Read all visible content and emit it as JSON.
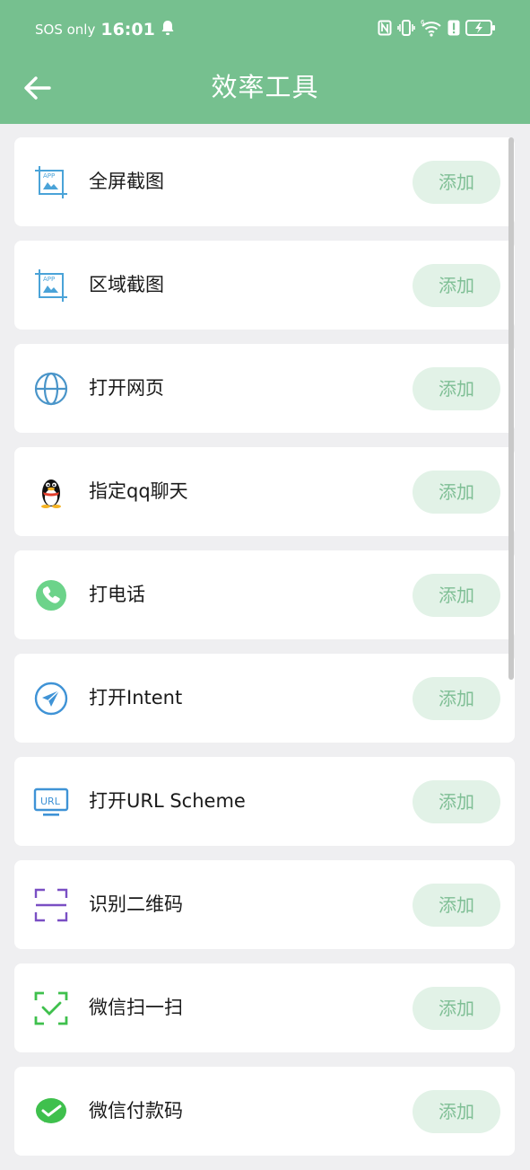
{
  "status_bar": {
    "carrier": "SOS only",
    "time": "16:01"
  },
  "header": {
    "title": "效率工具"
  },
  "items": [
    {
      "label": "全屏截图",
      "icon": "screenshot-app-icon",
      "action": "添加"
    },
    {
      "label": "区域截图",
      "icon": "screenshot-app-icon",
      "action": "添加"
    },
    {
      "label": "打开网页",
      "icon": "globe-icon",
      "action": "添加"
    },
    {
      "label": "指定qq聊天",
      "icon": "qq-penguin-icon",
      "action": "添加"
    },
    {
      "label": "打电话",
      "icon": "phone-icon",
      "action": "添加"
    },
    {
      "label": "打开Intent",
      "icon": "send-plane-icon",
      "action": "添加"
    },
    {
      "label": "打开URL Scheme",
      "icon": "url-monitor-icon",
      "action": "添加"
    },
    {
      "label": "识别二维码",
      "icon": "scan-frame-icon",
      "action": "添加"
    },
    {
      "label": "微信扫一扫",
      "icon": "wechat-scan-icon",
      "action": "添加"
    },
    {
      "label": "微信付款码",
      "icon": "wechat-pay-icon",
      "action": "添加"
    }
  ],
  "colors": {
    "header": "#76c08f",
    "button_bg": "#e2f2e7",
    "button_text": "#7fbf95"
  }
}
